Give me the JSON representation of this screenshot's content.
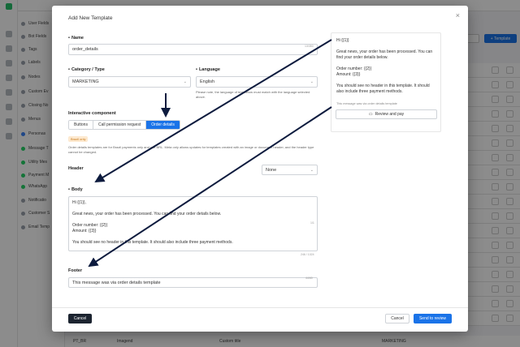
{
  "sidebar": {
    "items": [
      {
        "label": "User Fields",
        "icon": "list-icon"
      },
      {
        "label": "Bot Fields",
        "icon": "bot-icon"
      },
      {
        "label": "Tags",
        "icon": "tag-icon"
      },
      {
        "label": "Labels",
        "icon": "label-icon"
      },
      {
        "label": "Nodes",
        "icon": "node-icon"
      },
      {
        "label": "Custom Ev",
        "icon": "event-icon"
      },
      {
        "label": "Closing No",
        "icon": "closing-icon"
      },
      {
        "label": "Menus",
        "icon": "menu-icon"
      },
      {
        "label": "Personas",
        "icon": "persona-icon"
      },
      {
        "label": "Message T",
        "icon": "whatsapp-icon"
      },
      {
        "label": "Utility Mes",
        "icon": "whatsapp-icon"
      },
      {
        "label": "Payment M",
        "icon": "whatsapp-icon"
      },
      {
        "label": "WhatsApp",
        "icon": "whatsapp-icon"
      },
      {
        "label": "Notificatio",
        "icon": "bell-icon"
      },
      {
        "label": "Customer S",
        "icon": "customer-icon"
      },
      {
        "label": "Email Temp",
        "icon": "email-icon"
      }
    ]
  },
  "background": {
    "add_button": "+ Template",
    "bottom_row": {
      "lang": "PT_BR",
      "type": "Imagend",
      "name": "Custom title",
      "category": "MARKETING"
    }
  },
  "modal": {
    "title": "Add New Template",
    "close": "×",
    "name": {
      "label": "Name",
      "value": "order_details",
      "counter": "13/350"
    },
    "category": {
      "label": "Category / Type",
      "value": "MARKETING"
    },
    "language": {
      "label": "Language",
      "value": "English",
      "note": "Please note, the language of text below must match with the language selected above."
    },
    "interactive": {
      "label": "Interactive component",
      "options": [
        "Buttons",
        "Call permission request",
        "Order details"
      ],
      "active_index": 2,
      "badge": "Brazil only",
      "note": "Order details templates are for Brazil payments only and use BRL. Meta only allows updates for templates created with an image or document header, and the header type cannot be changed."
    },
    "header": {
      "label": "Header",
      "value": "None"
    },
    "body": {
      "label": "Body",
      "lines": [
        "Hi {{1}},",
        "",
        "Great news, your order has been processed. You can find your order details below.",
        "",
        "Order number: {{2}}",
        "Amount: {{3}}",
        "",
        "You should see no header in this template. It should also include three payment methods."
      ],
      "counter": "246 / 1024",
      "right_mark": "1/1"
    },
    "footer": {
      "label": "Footer",
      "value": "This message was via order details template",
      "counter": "44/60"
    },
    "buttons": {
      "left": "Cancel",
      "cancel": "Cancel",
      "submit": "Send to review"
    },
    "preview": {
      "greeting": "Hi {{1}}",
      "lines": [
        "Great news, your order has been processed. You can",
        "find your order details below.",
        "",
        "Order number: {{2}}",
        "Amount: {{3}}",
        "",
        "You should see no header in this template. It should",
        "also include three payment methods."
      ],
      "footer": "This message was via order details template",
      "button": "Review and pay"
    }
  },
  "colors": {
    "primary": "#1a73e8",
    "dark_button": "#1c2430",
    "arrow": "#0d1b3e",
    "badge_bg": "#fde9cf",
    "badge_fg": "#c77a1b",
    "whatsapp_green": "#25d366"
  }
}
